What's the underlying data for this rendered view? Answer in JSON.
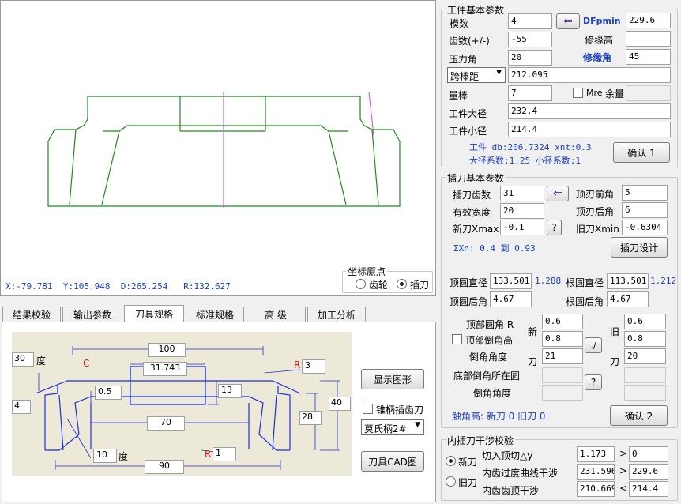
{
  "canvas": {
    "status_x": "X:-79.781",
    "status_y": "Y:105.948",
    "status_d": "D:265.254",
    "status_r": "R:132.627",
    "origin_title": "坐标原点",
    "origin_gear": "齿轮",
    "origin_cutter": "插刀",
    "origin_selected": "插刀"
  },
  "workpiece": {
    "title": "工件基本参数",
    "module_label": "模数",
    "module": "4",
    "teeth_label": "齿数(+/-)",
    "teeth": "-55",
    "pressure_label": "压力角",
    "pressure": "20",
    "measure_select": "跨棒距",
    "measure_value": "212.095",
    "pin_label": "量棒",
    "pin_value": "7",
    "mre_label": "Mre",
    "allowance_label": "余量",
    "allowance_value": "",
    "major_label": "工件大径",
    "major_value": "232.4",
    "minor_label": "工件小径",
    "minor_value": "214.4",
    "dfpmin_label": "DFpmin",
    "dfpmin_value": "229.6",
    "edge_height_label": "修缘高",
    "edge_height_value": "",
    "edge_angle_label": "修缘角",
    "edge_angle_value": "45",
    "info_line1": "工件 db:206.7324 xnt:0.3",
    "info_line2": "大径系数:1.25 小径系数:1",
    "confirm1": "确认 1"
  },
  "cutter": {
    "title": "插刀基本参数",
    "teeth_label": "插刀齿数",
    "teeth": "31",
    "width_label": "有效宽度",
    "width": "20",
    "xmax_label": "新刀Xmax",
    "xmax": "-0.1",
    "help": "?",
    "rake_label": "顶刃前角",
    "rake": "5",
    "relief_label": "顶刃后角",
    "relief": "6",
    "xmin_label": "旧刀Xmin",
    "xmin": "-0.6304",
    "sum_label": "ΣXn: 0.4 到 0.93",
    "design_button": "插刀设计",
    "tip_dia_label": "顶圆直径",
    "tip_dia": "133.501",
    "tip_coef": "1.288",
    "root_dia_label": "根圆直径",
    "root_dia": "113.501",
    "root_coef": "1.212",
    "tip_back_label": "顶圆后角",
    "tip_back": "4.67",
    "root_back_label": "根圆后角",
    "root_back": "4.67",
    "tip_fillet_label": "顶部圆角 R",
    "tip_chamfer_label": "顶部倒角高",
    "chamfer_angle_label": "倒角角度",
    "bottom_circle_label": "底部倒角所在圆",
    "bottom_angle_label": "倒角角度",
    "new_label": "新",
    "new_label2": "刀",
    "old_label": "旧",
    "old_label2": "刀",
    "new_fillet": "0.6",
    "new_chamfer": "0.8",
    "new_angle": "21",
    "old_fillet": "0.6",
    "old_chamfer": "0.8",
    "old_angle": "20",
    "copy_button": "./",
    "help2": "?",
    "contact_label": "触角高: 新刀 0  旧刀 0",
    "confirm2": "确认 2"
  },
  "interference": {
    "title": "内插刀干涉校验",
    "new_cutter": "新刀",
    "old_cutter": "旧刀",
    "selected": "新刀",
    "row1_label": "切入顶切△y",
    "row1_value": "1.173",
    "row1_op": ">",
    "row1_limit": "0",
    "row2_label": "内齿过度曲线干涉",
    "row2_value": "231.596",
    "row2_op": ">",
    "row2_limit": "229.6",
    "row3_label": "内齿齿顶干涉",
    "row3_value": "210.669",
    "row3_op": "<",
    "row3_limit": "214.4"
  },
  "tabs": [
    "结果校验",
    "输出参数",
    "刀具规格",
    "标准规格",
    "高 级",
    "加工分析"
  ],
  "active_tab": "刀具规格",
  "drawing": {
    "dim_100": "100",
    "dim_31743": "31.743",
    "dim_05": "0.5",
    "dim_13": "13",
    "dim_70": "70",
    "dim_10": "10",
    "dim_90": "90",
    "dim_30": "30",
    "dim_4": "4",
    "dim_28": "28",
    "dim_40": "40",
    "dim_r3": "3",
    "dim_r1": "1",
    "unit_deg1": "度",
    "unit_deg2": "度",
    "letter_c": "C",
    "letter_r1": "R",
    "letter_r2": "R"
  },
  "tool_panel": {
    "show_button": "显示图形",
    "taper_label": "锥柄插齿刀",
    "shank_select": "莫氏柄2#",
    "cad_button": "刀具CAD图"
  },
  "colors": {
    "profile_green": "#1f8a1f",
    "axis_magenta": "#e040e0",
    "label_blue": "#1a3fbf",
    "drawing_blue": "#1f2fd0"
  }
}
